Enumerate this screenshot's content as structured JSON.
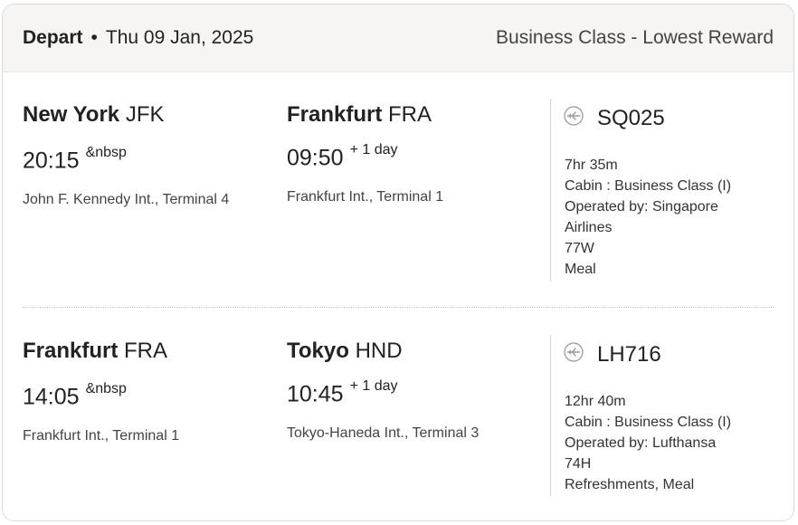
{
  "header": {
    "direction": "Depart",
    "separator": "•",
    "date": "Thu 09 Jan, 2025",
    "fare": "Business Class - Lowest Reward"
  },
  "segments": [
    {
      "origin_city": "New York",
      "origin_code": "JFK",
      "origin_time": "20:15",
      "origin_suffix": "&nbsp",
      "origin_airport": "John F. Kennedy Int., Terminal 4",
      "dest_city": "Frankfurt",
      "dest_code": "FRA",
      "dest_time": "09:50",
      "dest_suffix": "+ 1 day",
      "dest_airport": "Frankfurt Int., Terminal 1",
      "flight": "SQ025",
      "duration": "7hr 35m",
      "cabin": "Cabin : Business Class (I)",
      "operated_1": "Operated by: Singapore",
      "operated_2": "Airlines",
      "aircraft": "77W",
      "service": "Meal"
    },
    {
      "origin_city": "Frankfurt",
      "origin_code": "FRA",
      "origin_time": "14:05",
      "origin_suffix": "&nbsp",
      "origin_airport": "Frankfurt Int., Terminal 1",
      "dest_city": "Tokyo",
      "dest_code": "HND",
      "dest_time": "10:45",
      "dest_suffix": "+ 1 day",
      "dest_airport": "Tokyo-Haneda Int., Terminal 3",
      "flight": "LH716",
      "duration": "12hr 40m",
      "cabin": "Cabin : Business Class (I)",
      "operated_1": "Operated by: Lufthansa",
      "aircraft": "74H",
      "service": "Refreshments, Meal"
    }
  ],
  "icons": {
    "flight": "airplane-icon"
  }
}
